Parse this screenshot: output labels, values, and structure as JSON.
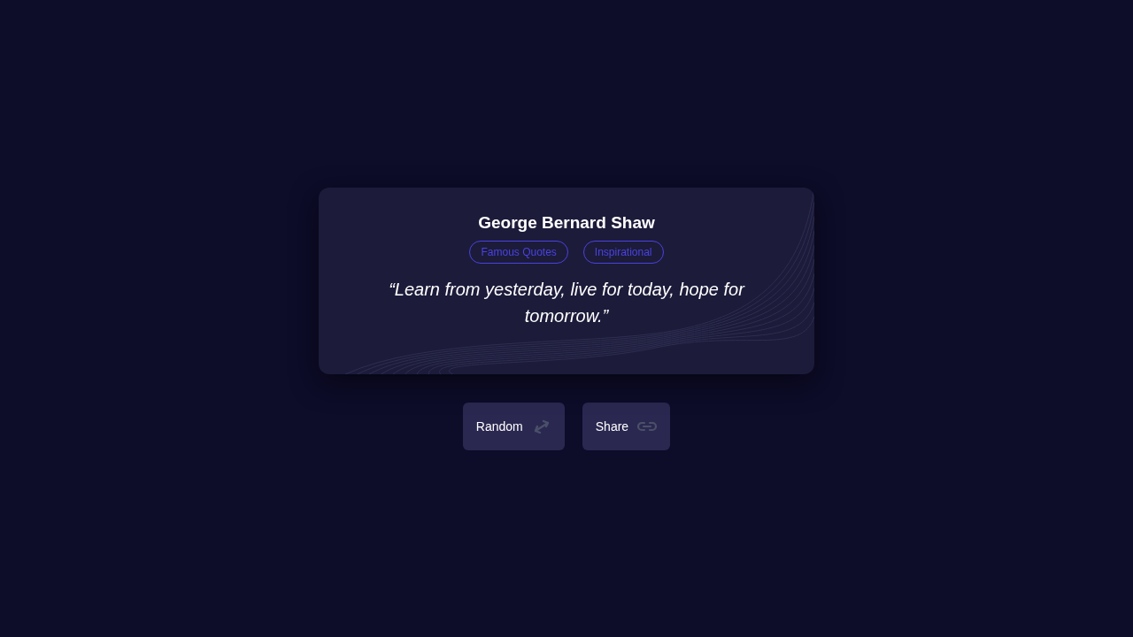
{
  "quote": {
    "author": "George Bernard Shaw",
    "tags": [
      "Famous Quotes",
      "Inspirational"
    ],
    "text": "“Learn from yesterday, live for today, hope for tomorrow.”"
  },
  "buttons": [
    {
      "label": "Random",
      "kind": "shuffle"
    },
    {
      "label": "Share",
      "kind": "link"
    }
  ]
}
